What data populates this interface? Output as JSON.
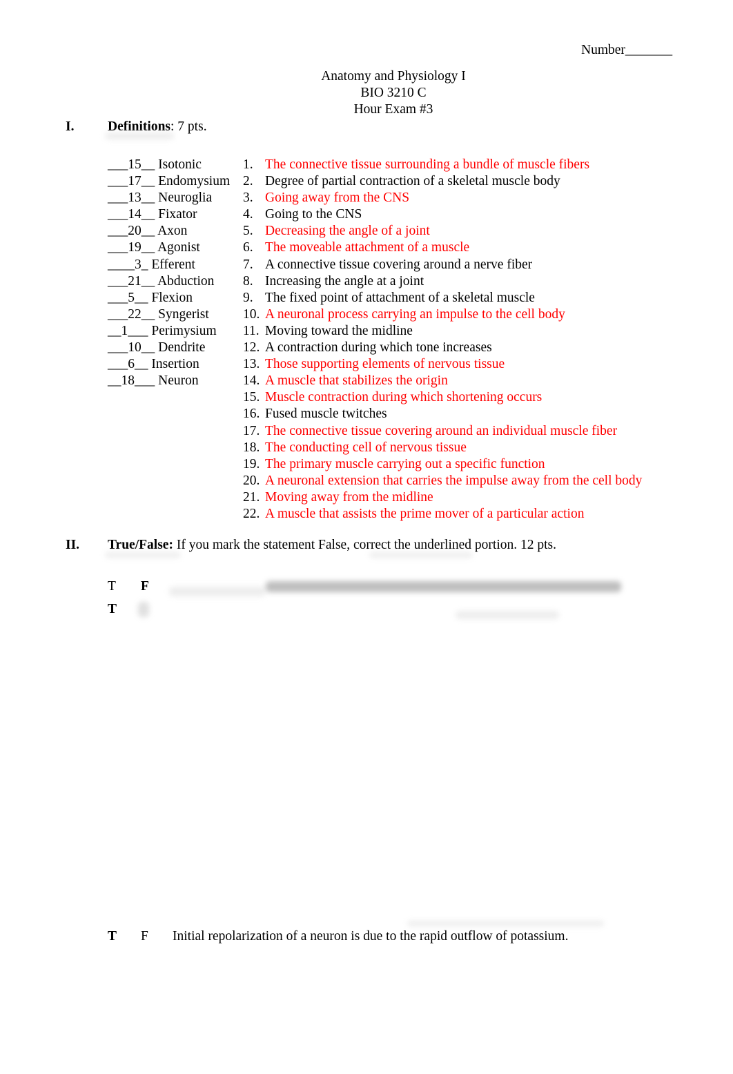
{
  "header": {
    "number_label": "Number_______",
    "course_title": "Anatomy and Physiology I",
    "course_code": "BIO 3210 C",
    "exam_title": "Hour Exam #3"
  },
  "section1": {
    "numeral": "I.",
    "title": "Definitions",
    "points": ": 7 pts.",
    "terms": [
      {
        "answer": "___15__ ",
        "term": "Isotonic"
      },
      {
        "answer": "___17__ ",
        "term": "Endomysium"
      },
      {
        "answer": "___13__ ",
        "term": "Neuroglia"
      },
      {
        "answer": "___14__ ",
        "term": "Fixator"
      },
      {
        "answer": "___20__ ",
        "term": "Axon"
      },
      {
        "answer": "___19__ ",
        "term": "Agonist"
      },
      {
        "answer": "____3_ ",
        "term": "Efferent"
      },
      {
        "answer": "___21__ ",
        "term": "Abduction"
      },
      {
        "answer": "___5__ ",
        "term": "Flexion"
      },
      {
        "answer": "___22__ ",
        "term": "Syngerist"
      },
      {
        "answer": "__1___ ",
        "term": "Perimysium"
      },
      {
        "answer": "___10__ ",
        "term": "Dendrite"
      },
      {
        "answer": "___6__ ",
        "term": "Insertion"
      },
      {
        "answer": "__18___ ",
        "term": "Neuron"
      }
    ],
    "definitions": [
      {
        "num": "1.",
        "text": "The connective tissue surrounding a bundle of muscle fibers",
        "highlighted": true
      },
      {
        "num": "2.",
        "text": "Degree of partial contraction of a skeletal muscle body",
        "highlighted": false
      },
      {
        "num": "3.",
        "text": "Going away from the CNS",
        "highlighted": true
      },
      {
        "num": "4.",
        "text": "Going to the CNS",
        "highlighted": false
      },
      {
        "num": "5.",
        "text": "Decreasing the angle of a joint",
        "highlighted": true
      },
      {
        "num": "6.",
        "text": "The moveable attachment of a muscle",
        "highlighted": true
      },
      {
        "num": "7.",
        "text": "A connective tissue covering around a nerve fiber",
        "highlighted": false
      },
      {
        "num": "8.",
        "text": "Increasing the angle at a joint",
        "highlighted": false
      },
      {
        "num": "9.",
        "text": "The fixed point of attachment of a skeletal muscle",
        "highlighted": false
      },
      {
        "num": "10.",
        "text": "A neuronal process carrying an impulse to the cell body",
        "highlighted": true
      },
      {
        "num": "11.",
        "text": "Moving toward the midline",
        "highlighted": false
      },
      {
        "num": "12.",
        "text": "A contraction during which tone increases",
        "highlighted": false
      },
      {
        "num": "13.",
        "text": "Those supporting elements of nervous tissue",
        "highlighted": true
      },
      {
        "num": "14.",
        "text": "A muscle that stabilizes the origin",
        "highlighted": true
      },
      {
        "num": "15.",
        "text": "Muscle contraction during which shortening occurs",
        "highlighted": true
      },
      {
        "num": "16.",
        "text": "Fused muscle twitches",
        "highlighted": false
      },
      {
        "num": "17.",
        "text": "The connective tissue covering around an individual muscle fiber",
        "highlighted": true
      },
      {
        "num": "18.",
        "text": "The conducting cell of nervous tissue",
        "highlighted": true
      },
      {
        "num": "19.",
        "text": "The primary muscle carrying out a specific function",
        "highlighted": true
      },
      {
        "num": "20.",
        "text": "A neuronal extension that carries the impulse away from the cell body",
        "highlighted": true
      },
      {
        "num": "21.",
        "text": "Moving away from the midline",
        "highlighted": true
      },
      {
        "num": "22.",
        "text": "A muscle that assists the prime mover of a particular action",
        "highlighted": true
      }
    ],
    "highlight_color": "#ff0000"
  },
  "section2": {
    "numeral": "II.",
    "title": "True/False:",
    "instructions": " If you mark the statement False, correct the underlined portion. 12 pts.",
    "questions": [
      {
        "t": "T",
        "f": "F",
        "selected": "F",
        "statement": ""
      },
      {
        "t": "T",
        "f": "F",
        "selected": "T",
        "statement": ""
      },
      {
        "t": "T",
        "f": "F",
        "selected": "T",
        "statement": "Initial repolarization of a neuron is due to the rapid outflow of potassium."
      }
    ]
  }
}
